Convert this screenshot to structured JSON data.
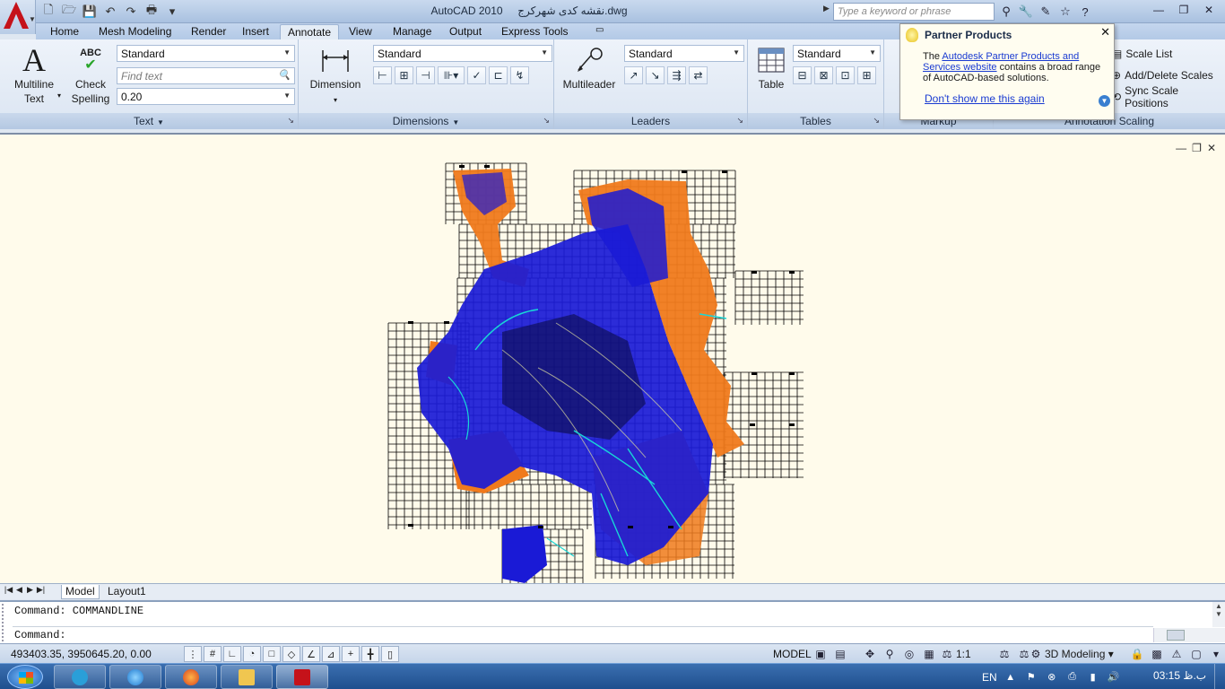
{
  "titlebar": {
    "app_name": "AutoCAD 2010",
    "file_name": "نقشه کدی شهرکرج.dwg",
    "search_placeholder": "Type a keyword or phrase"
  },
  "tabs": [
    {
      "label": "Home"
    },
    {
      "label": "Mesh Modeling"
    },
    {
      "label": "Render"
    },
    {
      "label": "Insert"
    },
    {
      "label": "Annotate",
      "active": true
    },
    {
      "label": "View"
    },
    {
      "label": "Manage"
    },
    {
      "label": "Output"
    },
    {
      "label": "Express Tools"
    }
  ],
  "ribbon": {
    "text_panel": {
      "title": "Text",
      "multiline_label_1": "Multiline",
      "multiline_label_2": "Text",
      "check_label_1": "Check",
      "check_label_2": "Spelling",
      "check_icon_text": "ABC",
      "style_value": "Standard",
      "find_placeholder": "Find text",
      "height_value": "0.20"
    },
    "dimensions_panel": {
      "title": "Dimensions",
      "dimension_label": "Dimension",
      "style_value": "Standard"
    },
    "leaders_panel": {
      "title": "Leaders",
      "multileader_label": "Multileader",
      "style_value": "Standard"
    },
    "tables_panel": {
      "title": "Tables",
      "table_label": "Table",
      "style_value": "Standard"
    },
    "markup_panel": {
      "title": "Markup"
    },
    "scaling_panel": {
      "title": "Annotation Scaling",
      "items": [
        "Scale List",
        "Add/Delete Scales",
        "Sync Scale Positions"
      ]
    }
  },
  "popup": {
    "title": "Partner Products",
    "body_pre": "The ",
    "body_link": "Autodesk Partner Products and Services website",
    "body_post": " contains a broad range of AutoCAD-based solutions.",
    "dont_show": "Don't show me this again"
  },
  "layout_tabs": [
    {
      "label": "Model",
      "active": true
    },
    {
      "label": "Layout1"
    }
  ],
  "command": {
    "history": "Command: COMMANDLINE",
    "prompt": "Command:"
  },
  "statusbar": {
    "coords": "493403.35, 3950645.20, 0.00",
    "model": "MODEL",
    "scale": "1:1",
    "workspace": "3D Modeling"
  },
  "taskbar": {
    "language": "EN",
    "clock": "03:15 ب.ظ"
  },
  "colors": {
    "map_blue": "#1a1ad6",
    "map_orange": "#f07a1c",
    "map_grid": "#000000",
    "map_cyan": "#18d6d6",
    "drawing_bg": "#fffbeb"
  }
}
